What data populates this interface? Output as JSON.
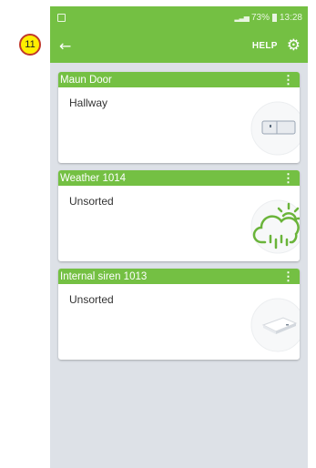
{
  "annotation": {
    "badge": "11"
  },
  "status_bar": {
    "battery": "73%",
    "time": "13:28"
  },
  "toolbar": {
    "help_label": "HELP"
  },
  "devices": [
    {
      "name": "Maun Door",
      "room": "Hallway",
      "icon": "door-sensor-icon"
    },
    {
      "name": "Weather 1014",
      "room": "Unsorted",
      "icon": "weather-icon"
    },
    {
      "name": "Internal siren 1013",
      "room": "Unsorted",
      "icon": "siren-icon"
    }
  ],
  "colors": {
    "accent": "#74c043",
    "background": "#dde1e7"
  }
}
